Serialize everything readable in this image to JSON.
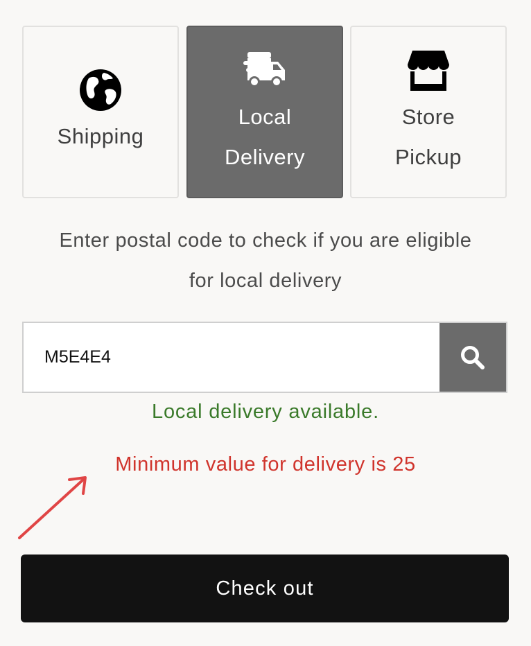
{
  "delivery_methods": [
    {
      "label_line1": "Shipping",
      "label_line2": "",
      "icon": "globe-icon",
      "selected": false
    },
    {
      "label_line1": "Local",
      "label_line2": "Delivery",
      "icon": "delivery-truck-icon",
      "selected": true
    },
    {
      "label_line1": "Store",
      "label_line2": "Pickup",
      "icon": "storefront-icon",
      "selected": false
    }
  ],
  "intro": {
    "line1": "Enter postal code to check if you are eligible",
    "line2": "for local delivery"
  },
  "postal_search": {
    "value": "M5E4E4",
    "button_icon": "search-icon"
  },
  "status": {
    "available": "Local delivery available.",
    "minimum": "Minimum value for delivery is 25"
  },
  "checkout": {
    "label": "Check out"
  },
  "colors": {
    "selected_tile": "#6b6b6b",
    "available_text": "#3a7a2a",
    "minimum_text": "#d0342c",
    "annotation_arrow": "#e04545",
    "checkout_bg": "#121212"
  }
}
